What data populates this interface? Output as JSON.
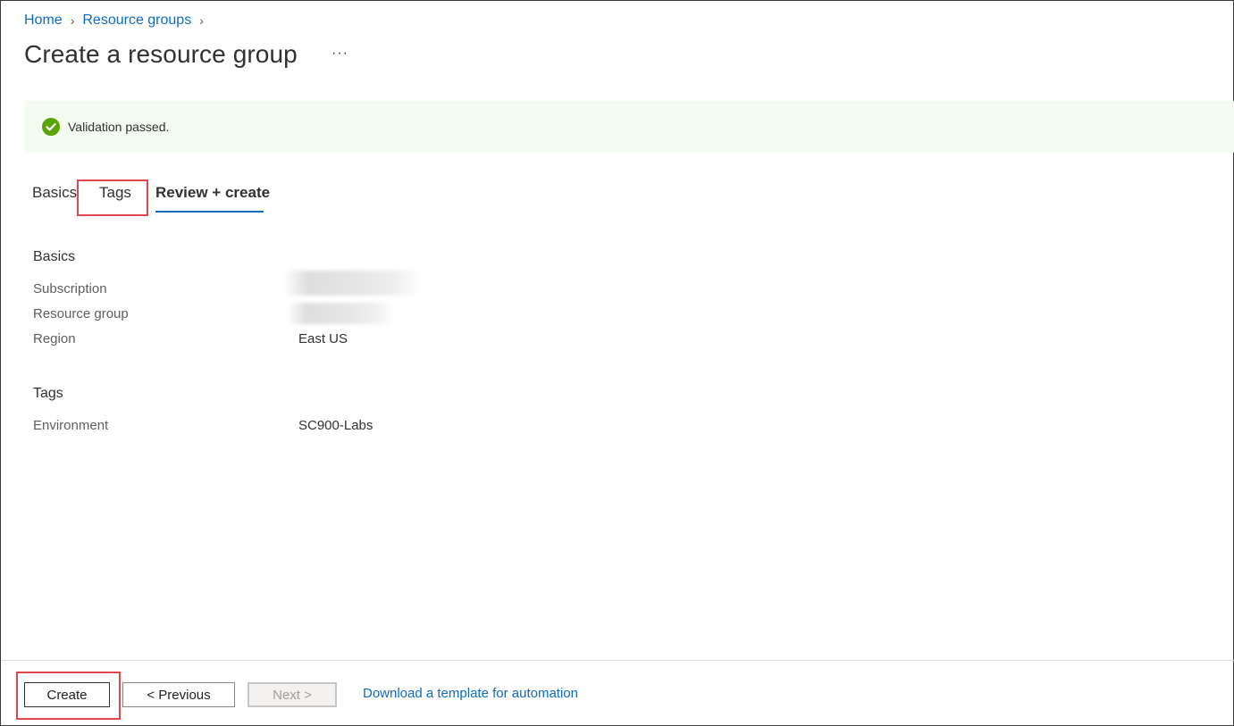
{
  "breadcrumb": {
    "items": [
      "Home",
      "Resource groups"
    ],
    "separator": ">"
  },
  "header": {
    "title": "Create a resource group",
    "more_label": "···"
  },
  "banner": {
    "text": "Validation passed.",
    "icon": "check-circle-icon",
    "color": "#57a300",
    "background": "#f4fbef"
  },
  "tabs": [
    {
      "label": "Basics",
      "active": false
    },
    {
      "label": "Tags",
      "active": false,
      "highlighted": true
    },
    {
      "label": "Review + create",
      "active": true
    }
  ],
  "review": {
    "basics": {
      "title": "Basics",
      "rows": [
        {
          "label": "Subscription",
          "value": "",
          "redacted": true
        },
        {
          "label": "Resource group",
          "value": "",
          "redacted": true
        },
        {
          "label": "Region",
          "value": "East US"
        }
      ]
    },
    "tags": {
      "title": "Tags",
      "rows": [
        {
          "label": "Environment",
          "value": "SC900-Labs"
        }
      ]
    }
  },
  "footer": {
    "create_label": "Create",
    "previous_label": "< Previous",
    "next_label": "Next >",
    "next_disabled": true,
    "download_link": "Download a template for automation"
  },
  "colors": {
    "link": "#0f6cbd",
    "highlight_box": "#e0474c",
    "tab_underline": "#0f6cbd"
  }
}
